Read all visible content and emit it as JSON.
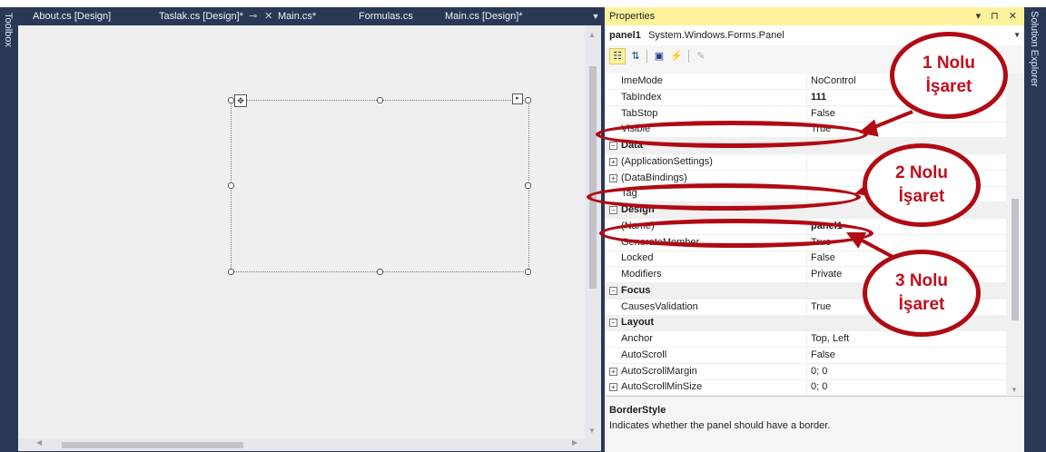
{
  "sidebars": {
    "toolbox": "Toolbox",
    "solution_explorer": "Solution Explorer"
  },
  "tabs": [
    {
      "label": "About.cs [Design]"
    },
    {
      "label": "Taslak.cs [Design]*",
      "pin": "⊸",
      "close": "✕"
    },
    {
      "label": "Main.cs*"
    },
    {
      "label": "Formulas.cs"
    },
    {
      "label": "Main.cs [Design]*"
    }
  ],
  "properties": {
    "title": "Properties",
    "title_buttons": "▾ ⊓ ✕",
    "object_name": "panel1",
    "object_type": "System.Windows.Forms.Panel",
    "toolbar_icons": [
      "categorized-icon",
      "alphabetical-icon",
      "properties-icon",
      "events-icon",
      "property-pages-icon"
    ],
    "rows": [
      {
        "kind": "prop",
        "name": "ImeMode",
        "value": "NoControl"
      },
      {
        "kind": "prop",
        "name": "TabIndex",
        "value": "111",
        "bold": true
      },
      {
        "kind": "prop",
        "name": "TabStop",
        "value": "False"
      },
      {
        "kind": "prop",
        "name": "Visible",
        "value": "True"
      },
      {
        "kind": "cat",
        "name": "Data"
      },
      {
        "kind": "prop",
        "name": "(ApplicationSettings)",
        "value": "",
        "expand": true
      },
      {
        "kind": "prop",
        "name": "(DataBindings)",
        "value": "",
        "expand": true
      },
      {
        "kind": "prop",
        "name": "Tag",
        "value": ""
      },
      {
        "kind": "cat",
        "name": "Design"
      },
      {
        "kind": "prop",
        "name": "(Name)",
        "value": "panel1",
        "bold": true
      },
      {
        "kind": "prop",
        "name": "GenerateMember",
        "value": "True"
      },
      {
        "kind": "prop",
        "name": "Locked",
        "value": "False"
      },
      {
        "kind": "prop",
        "name": "Modifiers",
        "value": "Private"
      },
      {
        "kind": "cat",
        "name": "Focus"
      },
      {
        "kind": "prop",
        "name": "CausesValidation",
        "value": "True"
      },
      {
        "kind": "cat",
        "name": "Layout"
      },
      {
        "kind": "prop",
        "name": "Anchor",
        "value": "Top, Left"
      },
      {
        "kind": "prop",
        "name": "AutoScroll",
        "value": "False"
      },
      {
        "kind": "prop",
        "name": "AutoScrollMargin",
        "value": "0; 0",
        "expand": true
      },
      {
        "kind": "prop",
        "name": "AutoScrollMinSize",
        "value": "0; 0",
        "expand": true
      }
    ],
    "description_title": "BorderStyle",
    "description_text": "Indicates whether the panel should have a border."
  },
  "annotations": [
    {
      "line1": "1 Nolu",
      "line2": "İşaret"
    },
    {
      "line1": "2 Nolu",
      "line2": "İşaret"
    },
    {
      "line1": "3 Nolu",
      "line2": "İşaret"
    }
  ],
  "colors": {
    "accent": "#b00a14",
    "title_highlight": "#fff29d",
    "chrome": "#293955"
  }
}
